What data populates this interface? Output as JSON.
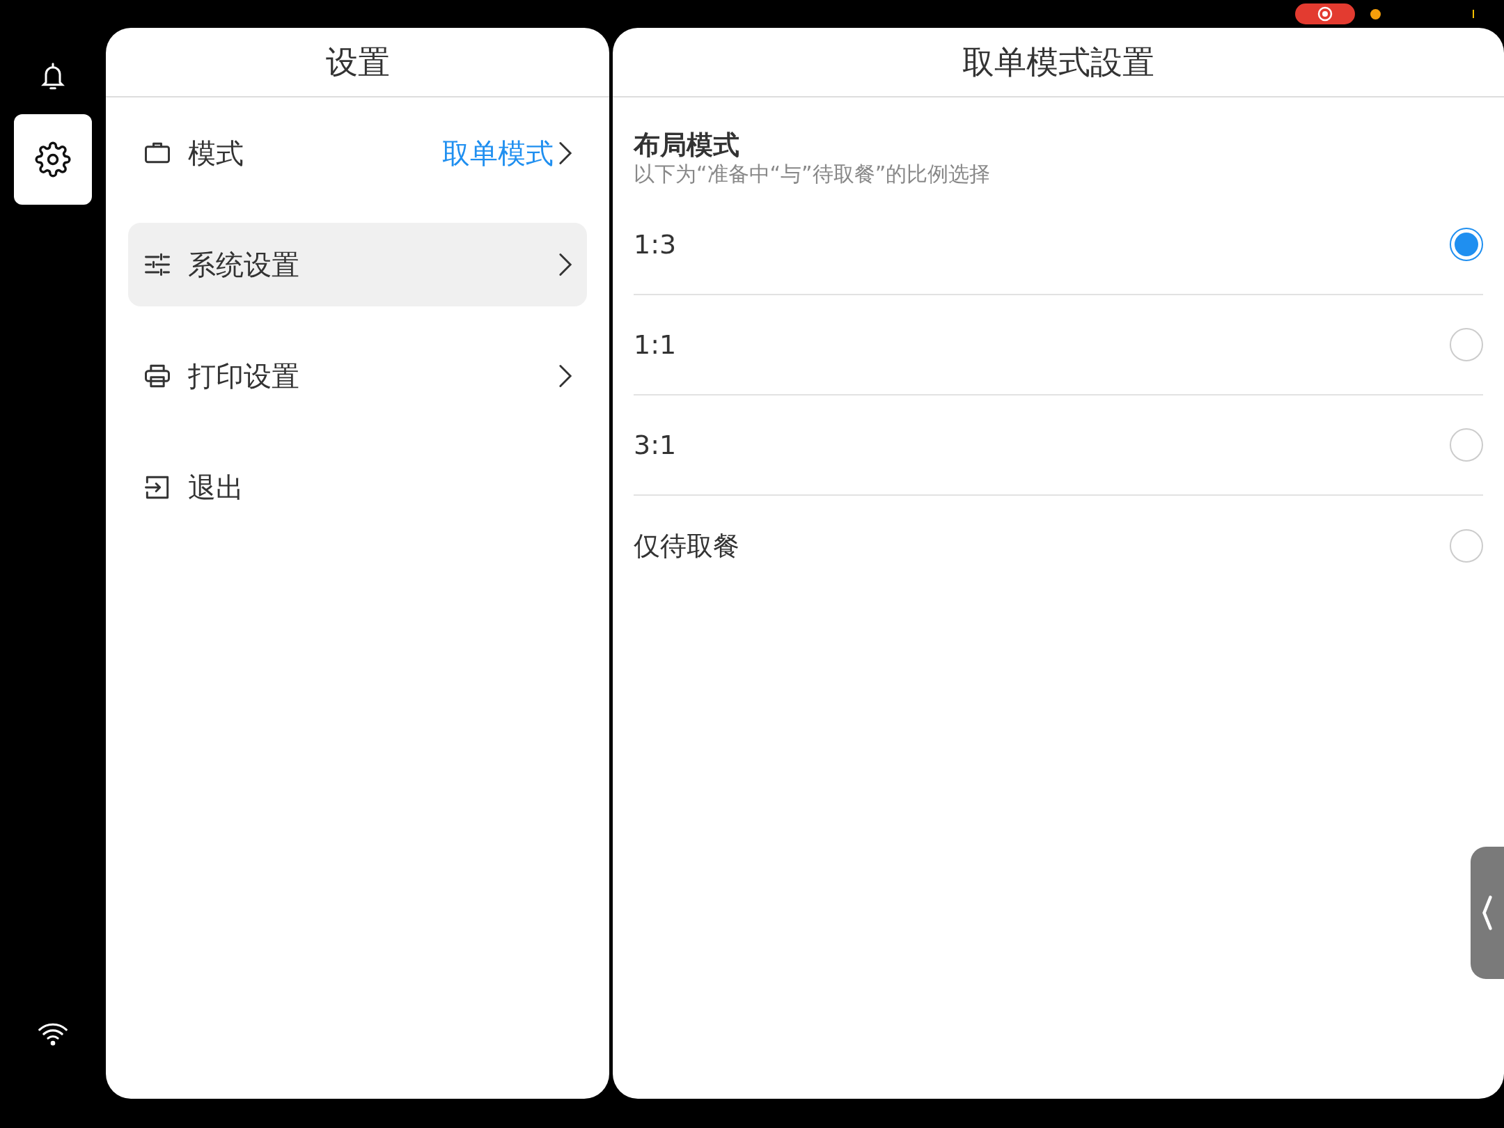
{
  "sidebar": {
    "items": [
      {
        "kind": "notifications",
        "selected": false
      },
      {
        "kind": "settings",
        "selected": true
      }
    ]
  },
  "settings_panel": {
    "title": "设置",
    "items": [
      {
        "kind": "mode",
        "label": "模式",
        "value": "取单模式",
        "chevron": true,
        "selected": false
      },
      {
        "kind": "system",
        "label": "系统设置",
        "chevron": true,
        "selected": true
      },
      {
        "kind": "print",
        "label": "打印设置",
        "chevron": true,
        "selected": false
      },
      {
        "kind": "logout",
        "label": "退出",
        "chevron": false,
        "selected": false
      }
    ]
  },
  "detail_panel": {
    "title": "取单模式設置",
    "section": {
      "title": "布局模式",
      "subtitle": "以下为“准备中“与”待取餐”的比例选择"
    },
    "options": [
      {
        "label": "1:3",
        "selected": true
      },
      {
        "label": "1:1",
        "selected": false
      },
      {
        "label": "3:1",
        "selected": false
      },
      {
        "label": "仅待取餐",
        "selected": false
      }
    ]
  }
}
